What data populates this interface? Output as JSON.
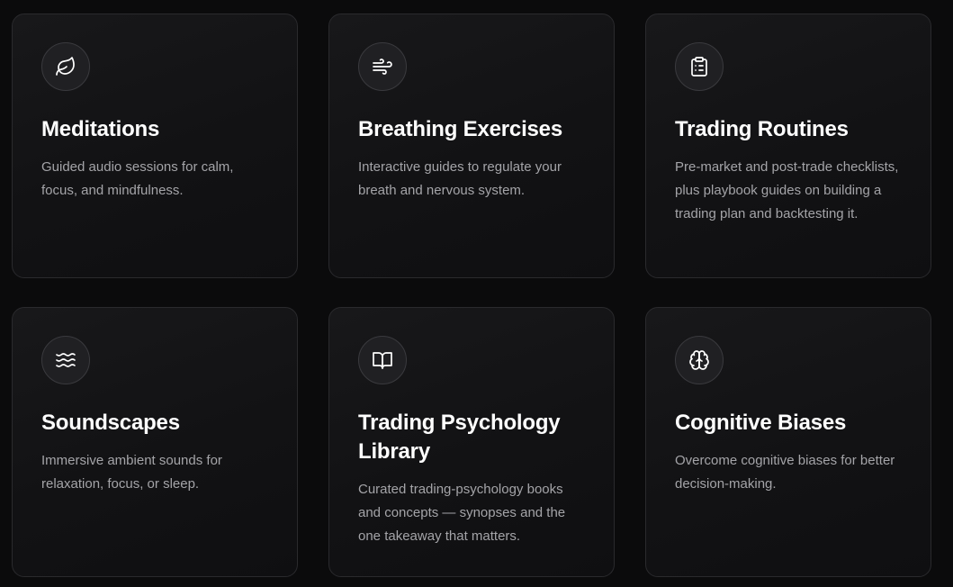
{
  "cards": [
    {
      "icon": "leaf-icon",
      "title": "Meditations",
      "description": "Guided audio sessions for calm, focus, and mindfulness."
    },
    {
      "icon": "wind-icon",
      "title": "Breathing Exercises",
      "description": "Interactive guides to regulate your breath and nervous system."
    },
    {
      "icon": "clipboard-list-icon",
      "title": "Trading Routines",
      "description": "Pre-market and post-trade checklists, plus playbook guides on building a trading plan and backtesting it."
    },
    {
      "icon": "waves-icon",
      "title": "Soundscapes",
      "description": "Immersive ambient sounds for relaxation, focus, or sleep."
    },
    {
      "icon": "open-book-icon",
      "title": "Trading Psychology Library",
      "description": "Curated trading-psychology books and concepts — synopses and the one takeaway that matters."
    },
    {
      "icon": "brain-icon",
      "title": "Cognitive Biases",
      "description": "Overcome cognitive biases for better decision-making."
    }
  ],
  "colors": {
    "background": "#0b0b0c",
    "card_border": "#2a2a2d",
    "title": "#ffffff",
    "description": "#a4a4a8"
  }
}
